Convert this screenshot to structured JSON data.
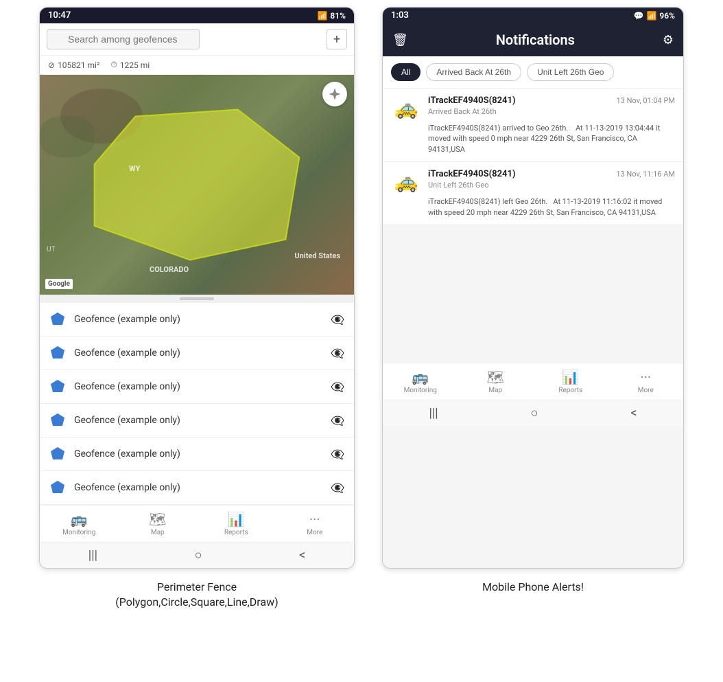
{
  "left_phone": {
    "status_bar": {
      "time": "10:47",
      "wifi": "WiFi",
      "signal": "81%",
      "battery": "81%"
    },
    "search": {
      "placeholder": "Search among geofences"
    },
    "stats": {
      "area": "105821 mi²",
      "distance": "1225 mi"
    },
    "map": {
      "labels": {
        "wy": "WY",
        "united_states": "United States",
        "ut": "UT",
        "colorado": "COLORADO"
      },
      "google_logo": "Google"
    },
    "geofence_items": [
      {
        "label": "Geofence (example only)"
      },
      {
        "label": "Geofence (example only)"
      },
      {
        "label": "Geofence (example only)"
      },
      {
        "label": "Geofence (example only)"
      },
      {
        "label": "Geofence (example only)"
      },
      {
        "label": "Geofence (example only)"
      }
    ],
    "bottom_nav": [
      {
        "label": "Monitoring",
        "icon": "🚌"
      },
      {
        "label": "Map",
        "icon": "🗺"
      },
      {
        "label": "Reports",
        "icon": "📊"
      },
      {
        "label": "More",
        "icon": "···"
      }
    ],
    "android_nav": [
      "|||",
      "○",
      "<"
    ]
  },
  "right_phone": {
    "status_bar": {
      "time": "1:03",
      "chat": "💬",
      "wifi": "WiFi",
      "signal": "96%",
      "battery": "96%"
    },
    "header": {
      "title": "Notifications",
      "delete_icon": "🗑",
      "settings_icon": "⚙"
    },
    "filter_tabs": [
      {
        "label": "All",
        "active": true
      },
      {
        "label": "Arrived Back At 26th",
        "active": false
      },
      {
        "label": "Unit Left 26th Geo",
        "active": false
      }
    ],
    "notifications": [
      {
        "device": "iTrackEF4940S(8241)",
        "time": "13 Nov, 01:04 PM",
        "tag": "Arrived Back At 26th",
        "body": "iTrackEF4940S(8241) arrived to Geo 26th.    At 11-13-2019 13:04:44 it moved with speed 0 mph near 4229 26th St, San Francisco, CA 94131,USA",
        "car_icon": "🚕"
      },
      {
        "device": "iTrackEF4940S(8241)",
        "time": "13 Nov, 11:16 AM",
        "tag": "Unit Left 26th Geo",
        "body": "iTrackEF4940S(8241) left Geo 26th.   At 11-13-2019 11:16:02 it moved with speed 20 mph near 4229 26th St, San Francisco, CA 94131,USA",
        "car_icon": "🚕"
      }
    ],
    "bottom_nav": [
      {
        "label": "Monitoring",
        "icon": "🚌"
      },
      {
        "label": "Map",
        "icon": "🗺"
      },
      {
        "label": "Reports",
        "icon": "📊"
      },
      {
        "label": "More",
        "icon": "···"
      }
    ],
    "android_nav": [
      "|||",
      "○",
      "<"
    ]
  },
  "captions": {
    "left": "Perimeter Fence\n(Polygon,Circle,Square,Line,Draw)",
    "right": "Mobile Phone Alerts!"
  }
}
